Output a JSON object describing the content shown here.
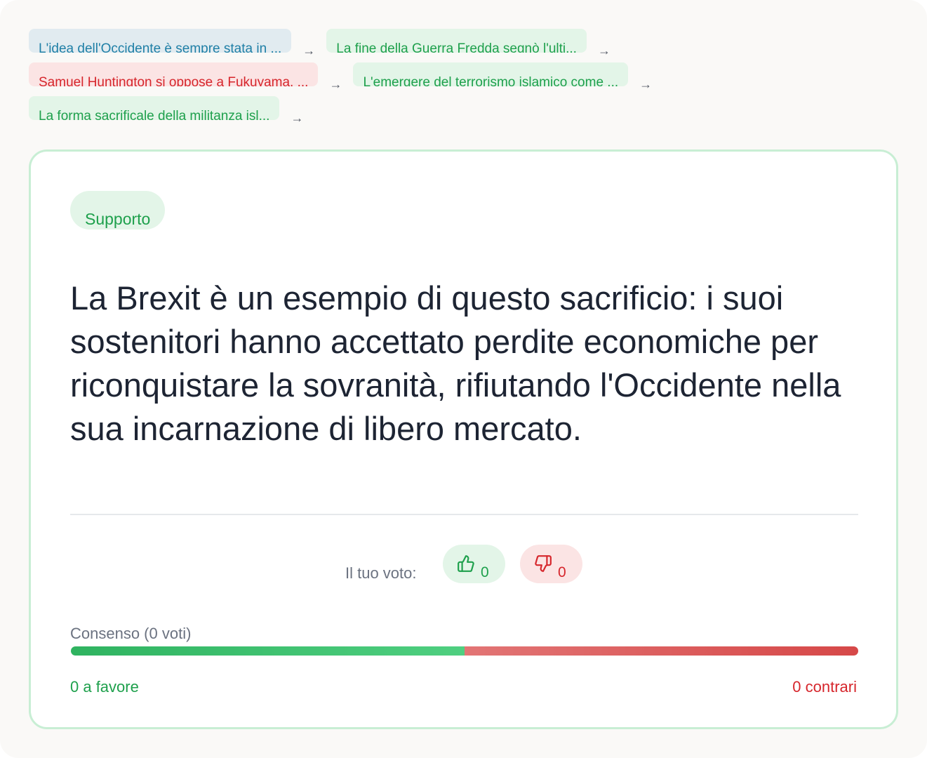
{
  "breadcrumb": {
    "items": [
      {
        "text": "L'idea dell'Occidente è sempre stata in ...",
        "type": "blue"
      },
      {
        "text": "La fine della Guerra Fredda segnò l'ulti...",
        "type": "green"
      },
      {
        "text": "Samuel Huntington si oppose a Fukuyama, ...",
        "type": "red"
      },
      {
        "text": "L'emergere del terrorismo islamico come ...",
        "type": "green"
      },
      {
        "text": "La forma sacrificale della militanza isl...",
        "type": "green"
      }
    ],
    "separator": "→"
  },
  "card": {
    "badge": "Supporto",
    "claim": "La Brexit è un esempio di questo sacrificio: i suoi sostenitori hanno accettato perdite economiche per riconquistare la sovranità, rifiutando l'Occidente nella sua incarnazione di libero mercato."
  },
  "vote": {
    "label": "Il tuo voto:",
    "up_icon": "thumbs-up-icon",
    "up_count": "0",
    "down_icon": "thumbs-down-icon",
    "down_count": "0"
  },
  "consensus": {
    "label": "Consenso (0 voti)",
    "pro_fraction": 0.5,
    "favor_label": "0 a favore",
    "against_label": "0 contrari"
  },
  "colors": {
    "green": "#1ea04c",
    "red": "#d6262c",
    "blue": "#1f7fa6",
    "card_border": "#c8eed4",
    "text": "#1d2433"
  }
}
